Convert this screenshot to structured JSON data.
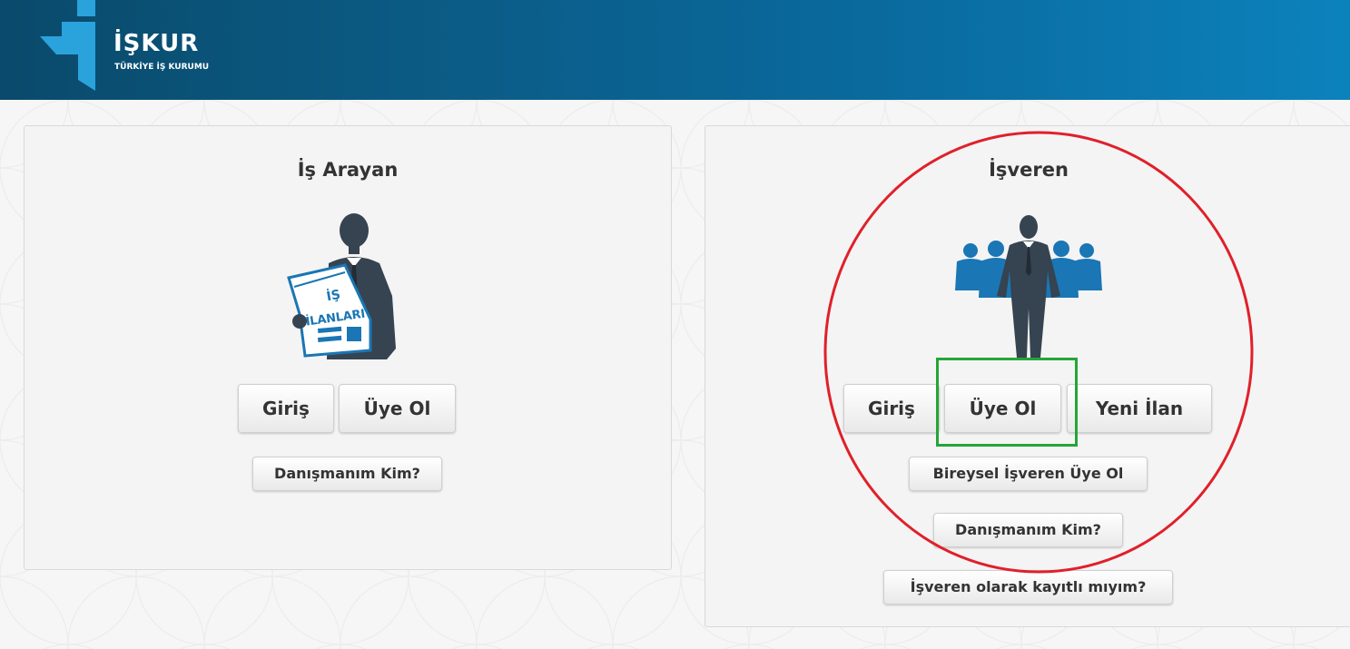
{
  "header": {
    "logo_title": "İŞKUR",
    "logo_subtitle": "TÜRKİYE İŞ KURUMU"
  },
  "job_seeker": {
    "title": "İş Arayan",
    "illustration_text_1": "İŞ",
    "illustration_text_2": "İLANLARI",
    "login_label": "Giriş",
    "register_label": "Üye Ol",
    "advisor_label": "Danışmanım Kim?"
  },
  "employer": {
    "title": "İşveren",
    "login_label": "Giriş",
    "register_label": "Üye Ol",
    "new_listing_label": "Yeni İlan",
    "individual_register_label": "Bireysel İşveren Üye Ol",
    "advisor_label": "Danışmanım Kim?",
    "registered_check_label": "İşveren olarak kayıtlı mıyım?"
  },
  "colors": {
    "header_dark": "#0a4a6b",
    "header_light": "#0c82bc",
    "figure_dark": "#364350",
    "figure_blue": "#1a76b4",
    "annotation_red": "#e0202a",
    "annotation_green": "#23a637"
  },
  "icons": [
    "iskur-logo-icon",
    "job-seeker-newspaper-icon",
    "employer-group-icon"
  ]
}
